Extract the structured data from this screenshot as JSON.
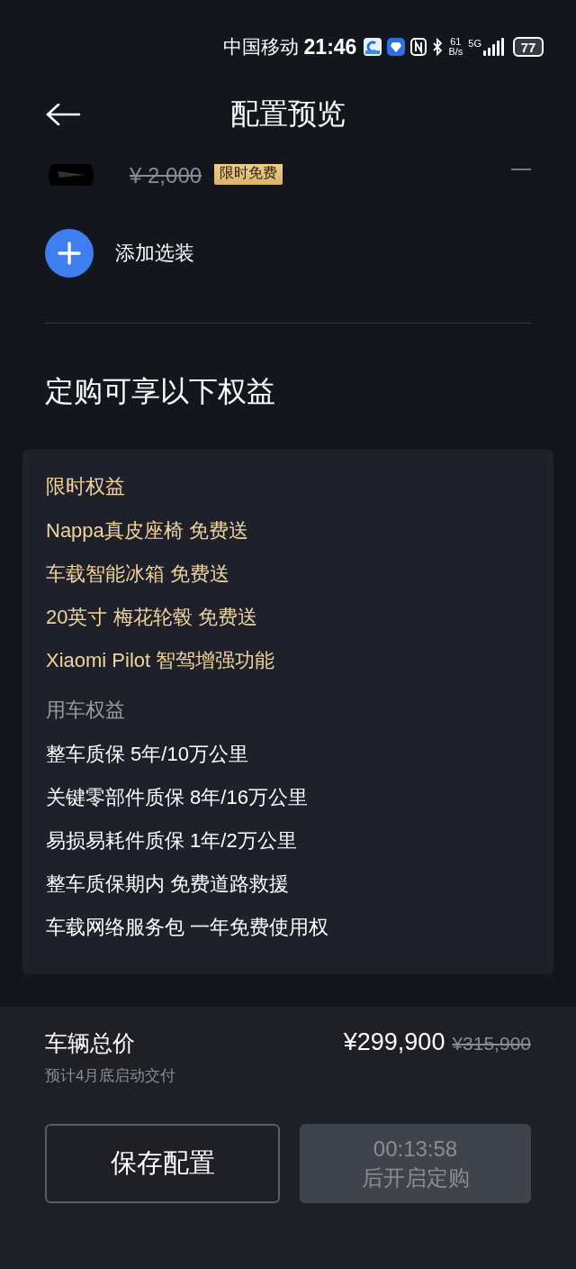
{
  "status_bar": {
    "carrier": "中国移动",
    "time": "21:46",
    "speed_value": "61",
    "speed_unit": "B/s",
    "network": "5G",
    "battery": "77"
  },
  "header": {
    "title": "配置预览"
  },
  "partial_option": {
    "price": "¥ 2,000",
    "badge": "限时免费"
  },
  "add_option": {
    "label": "添加选装"
  },
  "benefits_heading": "定购可享以下权益",
  "benefit_sections": [
    {
      "kind": "limited",
      "title": "限时权益",
      "items": [
        "Nappa真皮座椅 免费送",
        "车载智能冰箱 免费送",
        "20英寸 梅花轮毂 免费送",
        "Xiaomi Pilot 智驾增强功能"
      ]
    },
    {
      "kind": "standard",
      "title": "用车权益",
      "items": [
        "整车质保 5年/10万公里",
        "关键零部件质保 8年/16万公里",
        "易损易耗件质保 1年/2万公里",
        "整车质保期内 免费道路救援",
        "车载网络服务包 一年免费使用权"
      ]
    }
  ],
  "footer": {
    "total_label": "车辆总价",
    "price": "¥299,900",
    "original_price": "¥315,900",
    "delivery_note": "预计4月底启动交付",
    "buttons": [
      {
        "kind": "outline",
        "lines": [
          "保存配置"
        ],
        "disabled": false
      },
      {
        "kind": "filled",
        "lines": [
          "00:13:58",
          "后开启定购"
        ],
        "disabled": true
      }
    ]
  }
}
